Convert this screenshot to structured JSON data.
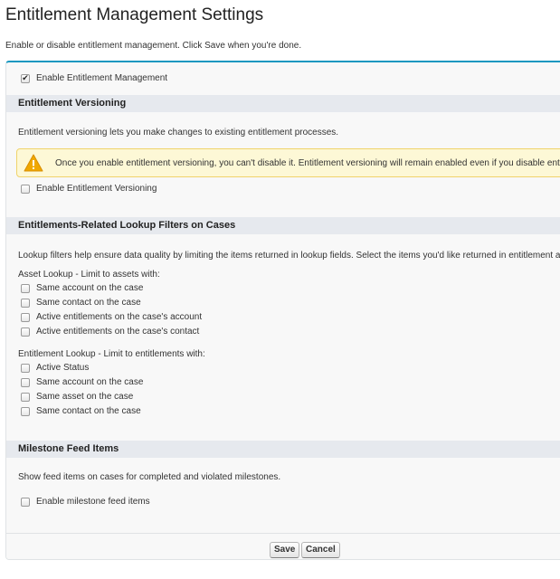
{
  "page": {
    "title": "Entitlement Management Settings",
    "description": "Enable or disable entitlement management. Click Save when you're done."
  },
  "enable_mgmt": {
    "label": "Enable Entitlement Management",
    "checked": true
  },
  "versioning": {
    "header": "Entitlement Versioning",
    "description": "Entitlement versioning lets you make changes to existing entitlement processes.",
    "warning": "Once you enable entitlement versioning, you can't disable it. Entitlement versioning will remain enabled even if you disable entitlement management.",
    "checkbox_label": "Enable Entitlement Versioning"
  },
  "lookup": {
    "header": "Entitlements-Related Lookup Filters on Cases",
    "description": "Lookup filters help ensure data quality by limiting the items returned in lookup fields. Select the items you'd like returned in entitlement and asset lookups.",
    "asset_title": "Asset Lookup - Limit to assets with:",
    "asset_items": [
      "Same account on the case",
      "Same contact on the case",
      "Active entitlements on the case's account",
      "Active entitlements on the case's contact"
    ],
    "ent_title": "Entitlement Lookup - Limit to entitlements with:",
    "ent_items": [
      "Active Status",
      "Same account on the case",
      "Same asset on the case",
      "Same contact on the case"
    ]
  },
  "milestone": {
    "header": "Milestone Feed Items",
    "description": "Show feed items on cases for completed and violated milestones.",
    "checkbox_label": "Enable milestone feed items"
  },
  "footer": {
    "save_label": "Save",
    "cancel_label": "Cancel"
  },
  "colors": {
    "accent": "#1797c0",
    "section_bg": "#e6e9ee",
    "warning_bg": "#fdf8d6",
    "warning_icon": "#f0a800"
  },
  "icons": {
    "warning": "warning-icon",
    "checkmark": "checkmark-icon"
  }
}
